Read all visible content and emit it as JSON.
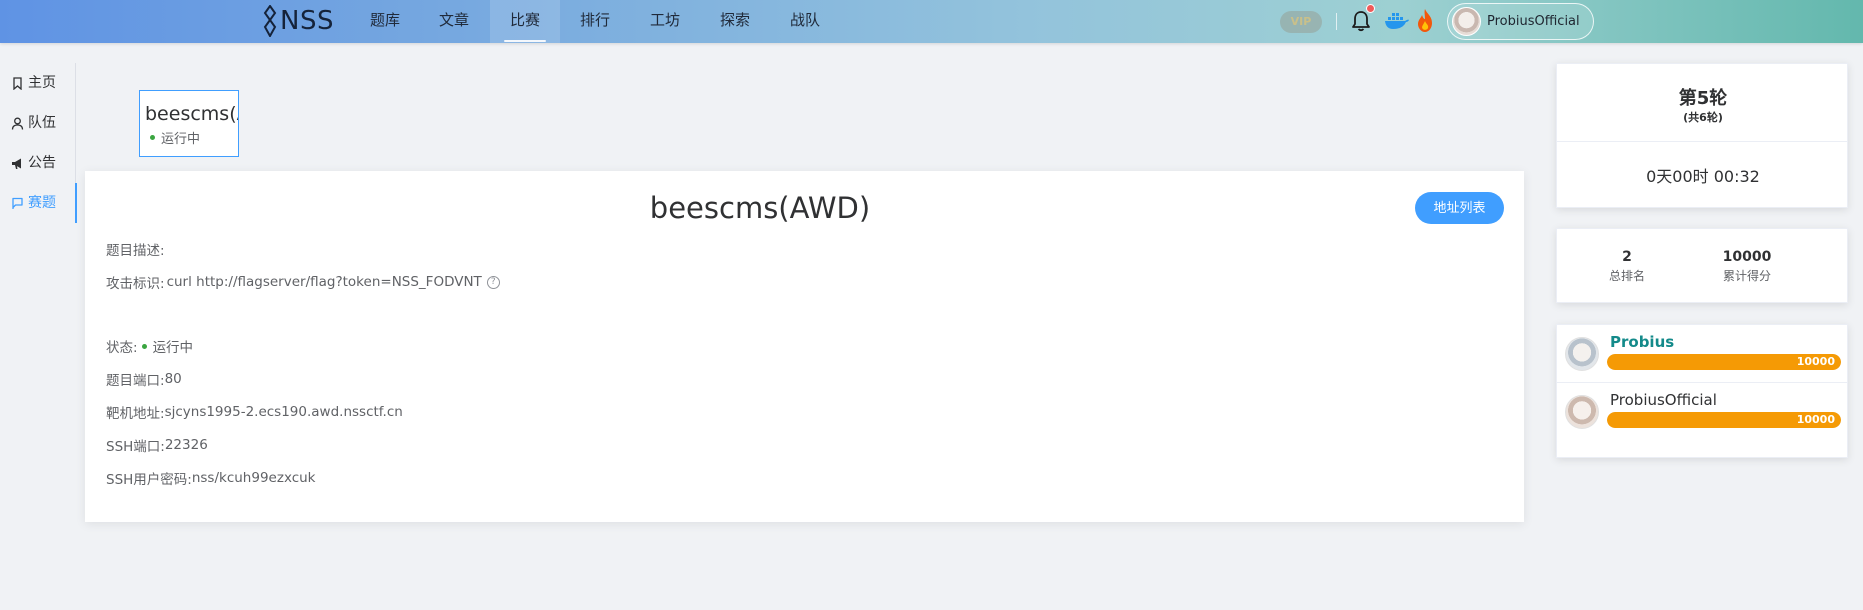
{
  "navbar": {
    "logo": "NSS",
    "items": [
      {
        "label": "题库"
      },
      {
        "label": "文章"
      },
      {
        "label": "比赛"
      },
      {
        "label": "排行"
      },
      {
        "label": "工坊"
      },
      {
        "label": "探索"
      },
      {
        "label": "战队"
      }
    ],
    "active_item": "比赛",
    "vip_label": "VIP",
    "icons": [
      "bell-icon",
      "docker-icon",
      "fire-icon"
    ],
    "user": {
      "name": "ProbiusOfficial"
    }
  },
  "sidebar": {
    "items": [
      {
        "label": "主页",
        "icon": "bookmark-icon"
      },
      {
        "label": "队伍",
        "icon": "user-icon"
      },
      {
        "label": "公告",
        "icon": "megaphone-icon"
      },
      {
        "label": "赛题",
        "icon": "flag-icon"
      }
    ],
    "active_item": "赛题"
  },
  "challenge_tab": {
    "title": "beescms(AWD)",
    "status": "运行中"
  },
  "challenge": {
    "title": "beescms(AWD)",
    "address_button": "地址列表",
    "description_label": "题目描述:",
    "attack_label": "攻击标识:",
    "attack_value": "curl http://flagserver/flag?token=NSS_FODVNT",
    "status_label": "状态:",
    "status_value": "运行中",
    "port_label": "题目端口:",
    "port_value": "80",
    "host_label": "靶机地址:",
    "host_value": "sjcyns1995-2.ecs190.awd.nssctf.cn",
    "ssh_port_label": "SSH端口:",
    "ssh_port_value": "22326",
    "ssh_cred_label": "SSH用户密码:",
    "ssh_cred_value": "nss/kcuh99ezxcuk"
  },
  "round": {
    "title": "第5轮",
    "subtitle": "(共6轮)",
    "countdown": "0天00时 00:32"
  },
  "stats": {
    "rank_value": "2",
    "rank_label": "总排名",
    "score_value": "10000",
    "score_label": "累计得分"
  },
  "scoreboard": [
    {
      "name": "Probius",
      "score": "10000",
      "fill": 1.0,
      "leader": true
    },
    {
      "name": "ProbiusOfficial",
      "score": "10000",
      "fill": 1.0,
      "leader": false
    }
  ],
  "colors": {
    "accent": "#409eff",
    "bar": "#f59a05",
    "leader_name": "#138a8a",
    "status_dot": "#3aa540"
  }
}
